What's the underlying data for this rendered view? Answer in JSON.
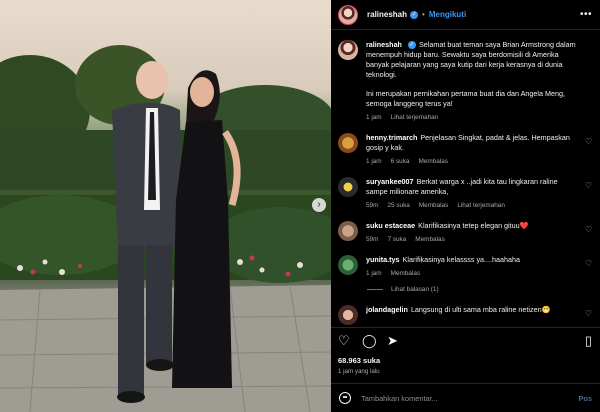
{
  "post": {
    "username": "ralineshah",
    "follow_label": "Mengikuti",
    "more_glyph": "•••"
  },
  "caption": {
    "username": "ralineshah",
    "paragraph1": "Selamat buat teman saya Brian Armstrong dalam menempuh hidup baru. Sewaktu saya berdomisili di Amerika banyak pelajaran yang saya kutip dari kerja kerasnya di dunia teknologi.",
    "paragraph2": "Ini merupakan pernikahan pertama buat dia dan Angela Meng, semoga langgeng terus ya!",
    "time": "1 jam",
    "translate": "Lihat terjemahan"
  },
  "comments": [
    {
      "username": "henny.trimarch",
      "text": "Penjelasan Singkat, padat & jelas. Hempaskan gosip y kak.",
      "time": "1 jam",
      "likes": "6 suka",
      "reply": "Membalas",
      "translate": ""
    },
    {
      "username": "suryankee007",
      "text": "Berkat warga x ..jadi kita tau lingkaran raline sampe milionare amerika,",
      "time": "59m",
      "likes": "25 suka",
      "reply": "Membalas",
      "translate": "Lihat terjemahan"
    },
    {
      "username": "suku estaceae",
      "text": "Klarifikasinya tetep elegan gituu❤️",
      "time": "59m",
      "likes": "7 suka",
      "reply": "Membalas",
      "translate": ""
    },
    {
      "username": "yunita.tys",
      "text": "Klarifikasinya kelassss ya....haahaha",
      "time": "1 jam",
      "likes": "",
      "reply": "Membalas",
      "translate": ""
    },
    {
      "username": "jolandagelin",
      "text": "Langsung di ulti sama mba raline netizen😁",
      "time": "",
      "likes": "",
      "reply": "",
      "translate": ""
    }
  ],
  "view_replies": "Lihat balasan (1)",
  "likes_count": "68.963 suka",
  "posted_time": "1 jam yang lalu",
  "add_comment": {
    "placeholder": "Tambahkan komentar...",
    "post_label": "Pos"
  },
  "colors": {
    "accent": "#3897f0",
    "like_red": "#ed4956",
    "bg": "#000000"
  }
}
